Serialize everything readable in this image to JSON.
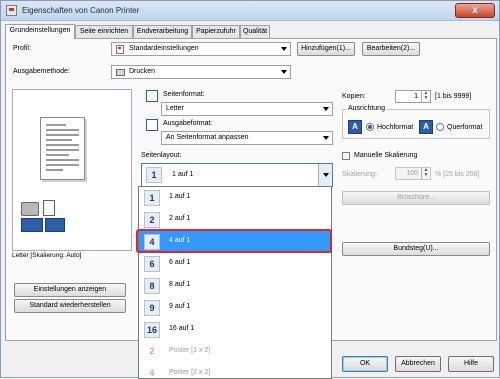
{
  "window": {
    "title": "Eigenschaften von Canon Printer",
    "close_label": "x"
  },
  "tabs": [
    {
      "label": "Grundeinstellungen"
    },
    {
      "label": "Seite einrichten"
    },
    {
      "label": "Endverarbeitung"
    },
    {
      "label": "Papierzufuhr"
    },
    {
      "label": "Qualität"
    }
  ],
  "profile": {
    "label": "Profil:",
    "value": "Standardeinstellungen",
    "add_button": "Hinzufügen(1)...",
    "edit_button": "Bearbeiten(2)..."
  },
  "output_method": {
    "label": "Ausgabemethode:",
    "value": "Drucken"
  },
  "page_format": {
    "label": "Seitenformat:",
    "value": "Letter"
  },
  "output_format": {
    "label": "Ausgabeformat:",
    "value": "An Seitenformat anpassen"
  },
  "page_layout": {
    "label": "Seitenlayout:",
    "value_num": "1",
    "value": "1 auf 1"
  },
  "dropdown_items": [
    {
      "num": "1",
      "label": "1 auf 1",
      "selected": false,
      "muted": false
    },
    {
      "num": "2",
      "label": "2 auf 1",
      "selected": false,
      "muted": false
    },
    {
      "num": "4",
      "label": "4 auf 1",
      "selected": true,
      "muted": false
    },
    {
      "num": "6",
      "label": "6 auf 1",
      "selected": false,
      "muted": false
    },
    {
      "num": "8",
      "label": "8 auf 1",
      "selected": false,
      "muted": false
    },
    {
      "num": "9",
      "label": "9 auf 1",
      "selected": false,
      "muted": false
    },
    {
      "num": "16",
      "label": "16 auf 1",
      "selected": false,
      "muted": false
    },
    {
      "num": "2",
      "label": "Poster [1 x 2]",
      "selected": false,
      "muted": true
    },
    {
      "num": "4",
      "label": "Poster [2 x 2]",
      "selected": false,
      "muted": true
    }
  ],
  "copies": {
    "label": "Kopien:",
    "value": "1",
    "range": "[1 bis 9999]"
  },
  "orientation": {
    "label": "Ausrichtung",
    "portrait": "Hochformat",
    "landscape": "Querformat",
    "selected": "portrait"
  },
  "manual_scaling": {
    "label": "Manuelle Skalierung",
    "checked": false,
    "scaling_label": "Skalierung:",
    "value": "100",
    "range": "% [25 bis 200]"
  },
  "browse_button": "Broschüre...",
  "gutter_button": "Bundsteg(U)...",
  "preview_status": "Letter [Skalierung: Auto]",
  "show_settings_button": "Einstellungen anzeigen",
  "restore_defaults_button": "Standard wiederherstellen",
  "footer": {
    "ok": "OK",
    "cancel": "Abbrechen",
    "help": "Hilfe"
  }
}
